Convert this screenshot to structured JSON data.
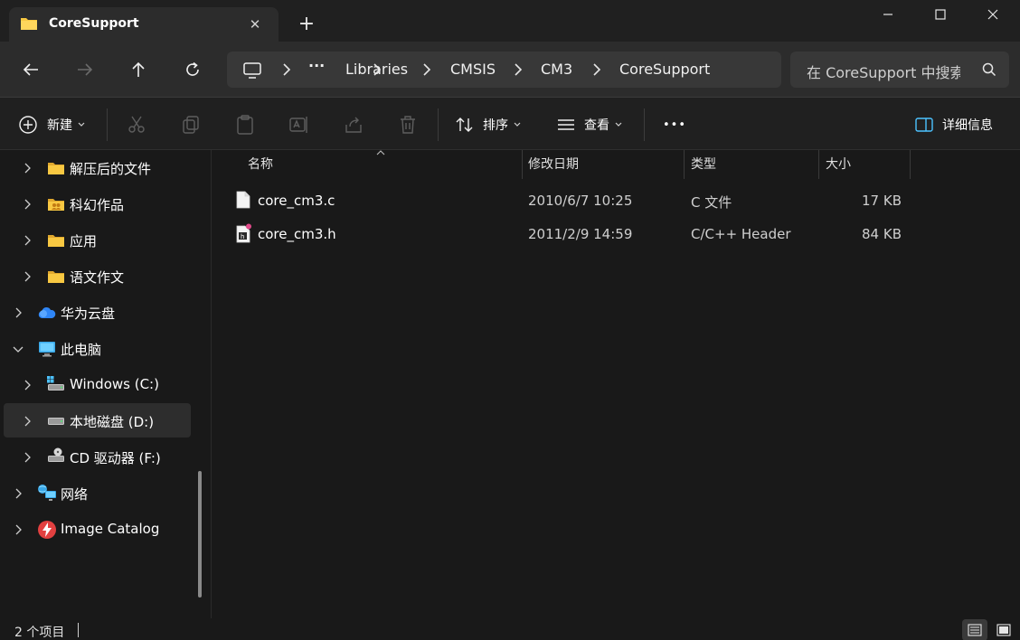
{
  "tab": {
    "title": "CoreSupport",
    "close": "✕",
    "new_tab": "+"
  },
  "window": {
    "minimize": "minimize",
    "maximize": "maximize",
    "close": "close"
  },
  "breadcrumb": {
    "ellipsis": "···",
    "items": [
      "Libraries",
      "CMSIS",
      "CM3",
      "CoreSupport"
    ]
  },
  "search": {
    "placeholder": "在 CoreSupport 中搜索"
  },
  "toolbar": {
    "new_label": "新建",
    "sort_label": "排序",
    "view_label": "查看",
    "more_label": "•••",
    "details_label": "详细信息"
  },
  "sidebar": {
    "items": [
      {
        "label": "解压后的文件",
        "icon": "folder-icon"
      },
      {
        "label": "科幻作品",
        "icon": "folder-shared-icon"
      },
      {
        "label": "应用",
        "icon": "folder-icon"
      },
      {
        "label": "语文作文",
        "icon": "folder-icon"
      },
      {
        "label": "华为云盘",
        "icon": "cloud-icon"
      },
      {
        "label": "此电脑",
        "icon": "computer-icon"
      },
      {
        "label": "Windows (C:)",
        "icon": "windows-drive-icon"
      },
      {
        "label": "本地磁盘 (D:)",
        "icon": "drive-icon"
      },
      {
        "label": "CD 驱动器 (F:)",
        "icon": "cd-drive-icon"
      },
      {
        "label": "网络",
        "icon": "network-icon"
      },
      {
        "label": "Image Catalog",
        "icon": "image-catalog-icon"
      }
    ]
  },
  "columns": {
    "name": "名称",
    "date": "修改日期",
    "type": "类型",
    "size": "大小"
  },
  "files": [
    {
      "name": "core_cm3.c",
      "date": "2010/6/7 10:25",
      "type": "C 文件",
      "size": "17 KB",
      "icon": "c-file-icon"
    },
    {
      "name": "core_cm3.h",
      "date": "2011/2/9 14:59",
      "type": "C/C++ Header",
      "size": "84 KB",
      "icon": "header-file-icon"
    }
  ],
  "status": {
    "count": "2 个项目"
  },
  "colors": {
    "accent": "#4cc2ff",
    "folder": "#f8c842",
    "bg": "#191919",
    "bar": "#2c2c2c"
  }
}
